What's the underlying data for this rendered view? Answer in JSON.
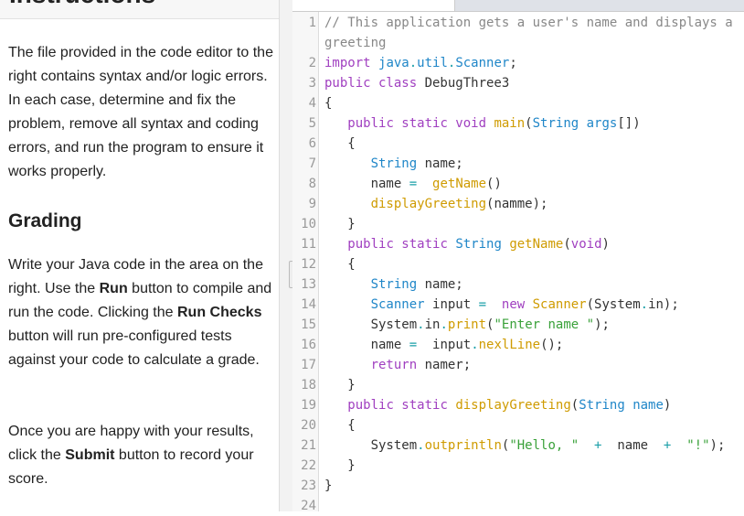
{
  "instructions": {
    "title": "Instructions",
    "intro": "The file provided in the code editor to the right contains syntax and/or logic errors. In each case, determine and fix the problem, remove all syntax and coding errors, and run the program to ensure it works properly.",
    "grading_title": "Grading",
    "grading_parts": [
      "Write your Java code in the area on the right. Use the ",
      "Run",
      " button to compile and run the code. Clicking the ",
      "Run Checks",
      " button will run pre-configured tests against your code to calculate a grade."
    ],
    "submit_parts": [
      "Once you are happy with your results, click the ",
      "Submit",
      " button to record your score."
    ]
  },
  "editor": {
    "lines": [
      [
        [
          "cm",
          "// This application gets a user's name and displays a greeting"
        ]
      ],
      [
        [
          "kw",
          "import "
        ],
        [
          "ty",
          "java"
        ],
        [
          "op",
          "."
        ],
        [
          "ty",
          "util"
        ],
        [
          "op",
          "."
        ],
        [
          "ty",
          "Scanner"
        ],
        [
          "",
          "; "
        ]
      ],
      [
        [
          "kw",
          "public class "
        ],
        [
          "",
          "DebugThree3"
        ]
      ],
      [
        [
          "",
          "{"
        ]
      ],
      [
        [
          "",
          "   "
        ],
        [
          "kw",
          "public static void "
        ],
        [
          "fn",
          "main"
        ],
        [
          "",
          "("
        ],
        [
          "ty",
          "String "
        ],
        [
          "ty",
          "args"
        ],
        [
          "",
          "[])"
        ]
      ],
      [
        [
          "",
          "   {"
        ]
      ],
      [
        [
          "",
          "      "
        ],
        [
          "ty",
          "String "
        ],
        [
          "",
          "name;"
        ]
      ],
      [
        [
          "",
          "      name "
        ],
        [
          "op",
          "="
        ],
        [
          "",
          "  "
        ],
        [
          "fn",
          "getName"
        ],
        [
          "",
          "()"
        ]
      ],
      [
        [
          "",
          "      "
        ],
        [
          "fn",
          "displayGreeting"
        ],
        [
          "",
          "(namme);"
        ]
      ],
      [
        [
          "",
          "   }"
        ]
      ],
      [
        [
          "",
          "   "
        ],
        [
          "kw",
          "public static "
        ],
        [
          "ty",
          "String "
        ],
        [
          "fn",
          "getName"
        ],
        [
          "",
          "("
        ],
        [
          "kw",
          "void"
        ],
        [
          "",
          ")"
        ]
      ],
      [
        [
          "",
          "   {"
        ]
      ],
      [
        [
          "",
          "      "
        ],
        [
          "ty",
          "String "
        ],
        [
          "",
          "name;"
        ]
      ],
      [
        [
          "",
          "      "
        ],
        [
          "ty",
          "Scanner "
        ],
        [
          "",
          "input "
        ],
        [
          "op",
          "="
        ],
        [
          "",
          "  "
        ],
        [
          "kw",
          "new "
        ],
        [
          "fn",
          "Scanner"
        ],
        [
          "",
          "(System"
        ],
        [
          "op",
          "."
        ],
        [
          "",
          "in);"
        ]
      ],
      [
        [
          "",
          "      System"
        ],
        [
          "op",
          "."
        ],
        [
          "",
          "in"
        ],
        [
          "op",
          "."
        ],
        [
          "fn",
          "print"
        ],
        [
          "",
          "("
        ],
        [
          "st",
          "\"Enter name \""
        ],
        [
          "",
          ");"
        ]
      ],
      [
        [
          "",
          "      name "
        ],
        [
          "op",
          "="
        ],
        [
          "",
          "  input"
        ],
        [
          "op",
          "."
        ],
        [
          "fn",
          "nexlLine"
        ],
        [
          "",
          "();"
        ]
      ],
      [
        [
          "",
          "      "
        ],
        [
          "kw",
          "return "
        ],
        [
          "",
          "namer;"
        ]
      ],
      [
        [
          "",
          "   }"
        ]
      ],
      [
        [
          "",
          "   "
        ],
        [
          "kw",
          "public static "
        ],
        [
          "fn",
          "displayGreeting"
        ],
        [
          "",
          "("
        ],
        [
          "ty",
          "String "
        ],
        [
          "ty",
          "name"
        ],
        [
          "",
          ")"
        ]
      ],
      [
        [
          "",
          "   {"
        ]
      ],
      [
        [
          "",
          "      System"
        ],
        [
          "op",
          "."
        ],
        [
          "fn",
          "outprintln"
        ],
        [
          "",
          "("
        ],
        [
          "st",
          "\"Hello, \""
        ],
        [
          "",
          "  "
        ],
        [
          "op",
          "+"
        ],
        [
          "",
          "  name  "
        ],
        [
          "op",
          "+"
        ],
        [
          "",
          "  "
        ],
        [
          "st",
          "\"!\""
        ],
        [
          "",
          ");"
        ]
      ],
      [
        [
          "",
          "   }"
        ]
      ],
      [
        [
          "",
          "}"
        ]
      ],
      [
        [
          "",
          ""
        ]
      ]
    ]
  }
}
